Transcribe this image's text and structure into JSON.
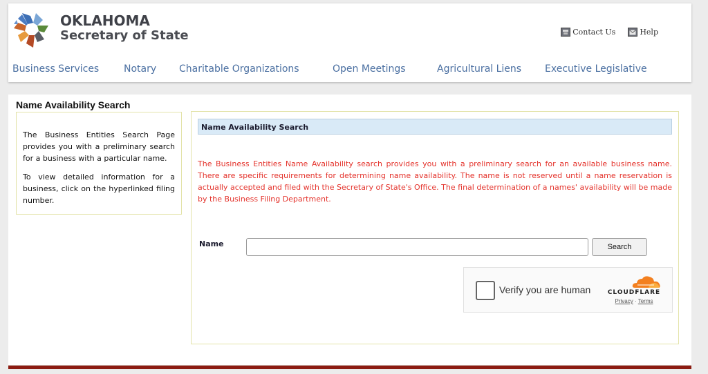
{
  "header": {
    "brand_line1": "OKLAHOMA",
    "brand_line2": "Secretary of State",
    "utility_links": [
      {
        "label": "Contact Us",
        "icon": "contact-icon"
      },
      {
        "label": "Help",
        "icon": "mail-icon"
      }
    ],
    "nav": [
      {
        "label": "Business Services"
      },
      {
        "label": "Notary"
      },
      {
        "label": "Charitable Organizations"
      },
      {
        "label": "Open Meetings"
      },
      {
        "label": "Agricultural Liens"
      },
      {
        "label": "Executive Legislative"
      }
    ]
  },
  "main": {
    "page_title": "Name Availability Search",
    "sidebar": {
      "paragraphs": [
        "The Business Entities Search Page provides you with a preliminary search for a business with a particular name.",
        "To view detailed information for a business, click on the hyperlinked filing number."
      ]
    },
    "form": {
      "section_title": "Name Availability Search",
      "notice": "The Business Entities Name Availability search provides you with a preliminary search for an available business name. There are specific requirements for determining name availability. The name is not reserved until a name reservation is actually accepted and filed with the Secretary of State's Office. The final determination of a names' availability will be made by the Business Filing Department.",
      "name_label": "Name",
      "name_value": "",
      "search_label": "Search",
      "notice_color": "#e4322b"
    },
    "captcha": {
      "label": "Verify you are human",
      "brand": "CLOUDFLARE",
      "privacy": "Privacy",
      "separator": "·",
      "terms": "Terms",
      "checked": false
    }
  },
  "colors": {
    "nav_link": "#4a6fa1",
    "footer_bar": "#8c1c12",
    "section_header_bg": "#d9eaf7",
    "box_border": "#e3e3a8"
  }
}
